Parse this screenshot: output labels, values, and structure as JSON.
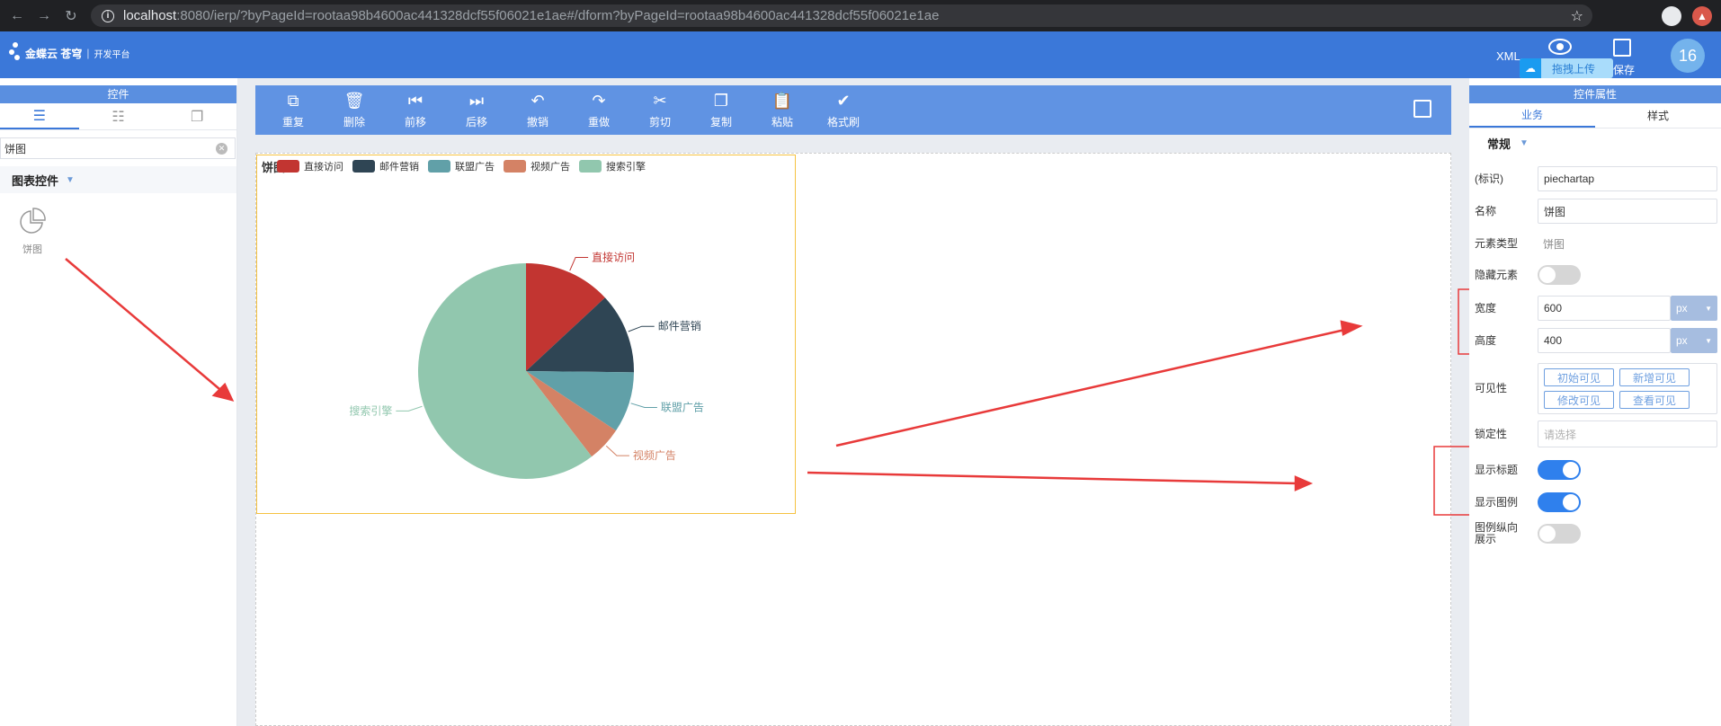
{
  "browser": {
    "url_host": "localhost",
    "url_rest": ":8080/ierp/?byPageId=rootaa98b4600ac441328dcf55f06021e1ae#/dform?byPageId=rootaa98b4600ac441328dcf55f06021e1ae"
  },
  "header": {
    "brand": "金蝶云 苍穹",
    "subtitle": "开发平台",
    "xml_label": "XML",
    "save_label": "保存",
    "upload_badge": "拖拽上传",
    "avatar_text": "16"
  },
  "left_panel": {
    "title": "控件",
    "search_value": "饼图",
    "group_label": "图表控件",
    "widgets": [
      {
        "label": "饼图",
        "icon": "pie-chart-icon"
      }
    ]
  },
  "toolbar": {
    "items": [
      {
        "label": "重复",
        "icon": "duplicate-icon"
      },
      {
        "label": "删除",
        "icon": "trash-icon"
      },
      {
        "label": "前移",
        "icon": "move-forward-icon"
      },
      {
        "label": "后移",
        "icon": "move-back-icon"
      },
      {
        "label": "撤销",
        "icon": "undo-icon"
      },
      {
        "label": "重做",
        "icon": "redo-icon"
      },
      {
        "label": "剪切",
        "icon": "cut-icon"
      },
      {
        "label": "复制",
        "icon": "copy-icon"
      },
      {
        "label": "粘贴",
        "icon": "paste-icon"
      },
      {
        "label": "格式刷",
        "icon": "format-brush-icon"
      }
    ]
  },
  "chart_data": {
    "type": "pie",
    "title": "饼图",
    "legend_position": "top-left",
    "categories": [
      "直接访问",
      "邮件营销",
      "联盟广告",
      "视频广告",
      "搜索引擎"
    ],
    "values": [
      335,
      310,
      234,
      135,
      1548
    ],
    "colors": [
      "#c23531",
      "#2f4554",
      "#61a0a8",
      "#d48265",
      "#91c7ae"
    ]
  },
  "right_panel": {
    "title": "控件属性",
    "tabs": [
      "业务",
      "样式"
    ],
    "section": "常规",
    "props": {
      "key_label": "(标识)",
      "key_value": "piechartap",
      "name_label": "名称",
      "name_value": "饼图",
      "type_label": "元素类型",
      "type_value": "饼图",
      "hidden_label": "隐藏元素",
      "width_label": "宽度",
      "width_value": "600",
      "width_unit": "px",
      "height_label": "高度",
      "height_value": "400",
      "height_unit": "px",
      "visibility_label": "可见性",
      "visibility_buttons": [
        "初始可见",
        "新增可见",
        "修改可见",
        "查看可见"
      ],
      "lock_label": "锁定性",
      "lock_placeholder": "请选择",
      "show_title_label": "显示标题",
      "show_legend_label": "显示图例",
      "legend_vertical_label": "图例纵向展示"
    },
    "toggles": {
      "hidden": false,
      "show_title": true,
      "show_legend": true,
      "legend_vertical": false
    }
  },
  "colors": {
    "header_blue": "#3b78d9",
    "toolbar_blue": "#6093e3",
    "switch_on": "#2f80ed",
    "annotation_red": "#e83a3a"
  }
}
